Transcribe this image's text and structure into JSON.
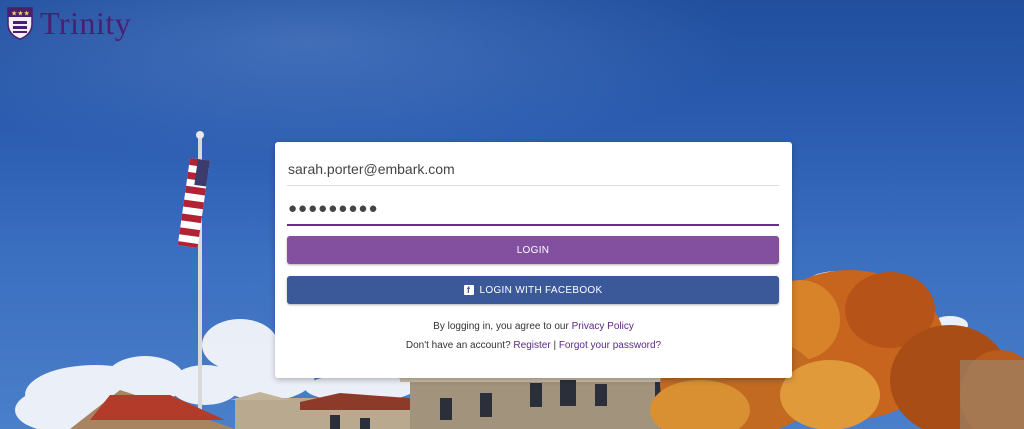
{
  "brand": {
    "name": "Trinity",
    "logo_icon": "shield-crest-icon",
    "colors": {
      "brand_purple": "#4b1f6f",
      "login_button": "#8350a0",
      "facebook_button": "#3b5998",
      "link": "#5b2a86"
    }
  },
  "login": {
    "email_value": "sarah.porter@embark.com",
    "password_value": "●●●●●●●●●",
    "login_button": "LOGIN",
    "facebook_button": "LOGIN WITH FACEBOOK",
    "facebook_icon": "facebook-icon",
    "terms_prefix": "By logging in, you agree to our ",
    "privacy_link": "Privacy Policy",
    "account_prefix": "Don't have an account? ",
    "register_link": "Register",
    "separator": " | ",
    "forgot_link": "Forgot your password?"
  }
}
